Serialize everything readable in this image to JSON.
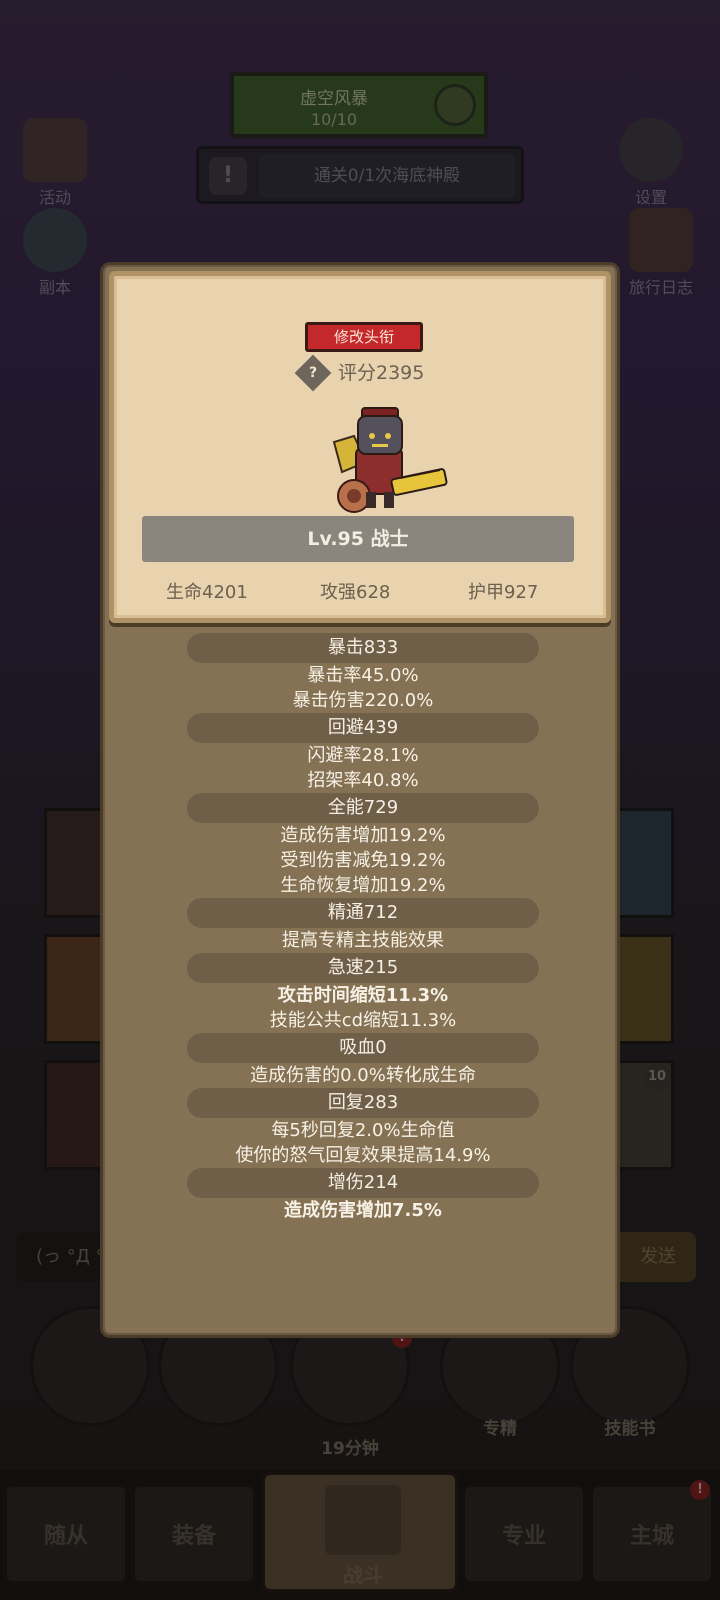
{
  "background": {
    "top_quest": {
      "title": "虚空风暴",
      "count": "10/10"
    },
    "mission": {
      "icon": "exclamation-icon",
      "text": "通关0/1次海底神殿"
    },
    "side_buttons": [
      {
        "label": "活动",
        "icon": "scroll-icon"
      },
      {
        "label": "设置",
        "icon": "gear-icon"
      },
      {
        "label": "副本",
        "icon": "portal-icon"
      },
      {
        "label": "旅行日志",
        "icon": "book-icon"
      }
    ],
    "chat_placeholder": "(っ °Д °",
    "send_label": "发送",
    "item_badge": "10",
    "round_buttons": [
      {
        "label": "",
        "icon": "potion-icon"
      },
      {
        "label": "",
        "icon": "bread-icon"
      },
      {
        "label": "19分钟",
        "icon": "chest-icon"
      },
      {
        "label": "专精",
        "icon": "target-icon"
      },
      {
        "label": "技能书",
        "icon": "skillbook-icon"
      }
    ],
    "nav_tabs": [
      "随从",
      "装备",
      "战斗",
      "专业",
      "主城"
    ]
  },
  "profile": {
    "edit_title_button": "修改头衔",
    "help_icon": "question-icon",
    "help_glyph": "?",
    "score": "评分2395",
    "avatar_icon": "warrior-avatar-icon",
    "level_class": "Lv.95 战士",
    "base_stats": [
      "生命4201",
      "攻强628",
      "护甲927"
    ]
  },
  "stat_groups": [
    {
      "header": "暴击833",
      "lines": [
        "暴击率45.0%",
        "暴击伤害220.0%"
      ]
    },
    {
      "header": "回避439",
      "lines": [
        "闪避率28.1%",
        "招架率40.8%"
      ]
    },
    {
      "header": "全能729",
      "lines": [
        "造成伤害增加19.2%",
        "受到伤害减免19.2%",
        "生命恢复增加19.2%"
      ]
    },
    {
      "header": "精通712",
      "lines": [
        "提高专精主技能效果"
      ]
    },
    {
      "header": "急速215",
      "lines": [
        "攻击时间缩短11.3%",
        "技能公共cd缩短11.3%"
      ]
    },
    {
      "header": "吸血0",
      "lines": [
        "造成伤害的0.0%转化成生命"
      ]
    },
    {
      "header": "回复283",
      "lines": [
        "每5秒回复2.0%生命值",
        "使你的怒气回复效果提高14.9%"
      ]
    },
    {
      "header": "增伤214",
      "lines": [
        "造成伤害增加7.5%"
      ]
    }
  ],
  "colors": {
    "accent_red": "#c4282a",
    "panel": "#857254",
    "card": "#e8d3ae"
  }
}
